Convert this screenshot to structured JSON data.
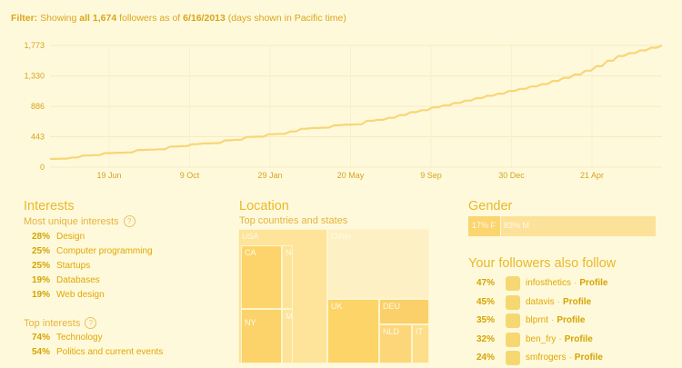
{
  "filter": {
    "label": "Filter:",
    "text1": " Showing ",
    "all_count": "all 1,674",
    "text2": " followers as of ",
    "date": "6/16/2013",
    "text3": " (days shown in Pacific time)"
  },
  "chart_data": {
    "type": "line",
    "x_tick_labels": [
      "19 Jun",
      "9 Oct",
      "29 Jan",
      "20 May",
      "9 Sep",
      "30 Dec",
      "21 Apr"
    ],
    "y_tick_labels": [
      "0",
      "443",
      "886",
      "1,330",
      "1,773"
    ],
    "ylim": [
      0,
      1773
    ],
    "grid": true,
    "series": [
      {
        "values": [
          120,
          125,
          140,
          170,
          175,
          205,
          210,
          215,
          250,
          255,
          260,
          300,
          305,
          335,
          345,
          350,
          390,
          400,
          440,
          445,
          480,
          485,
          520,
          560,
          570,
          575,
          610,
          620,
          625,
          675,
          690,
          720,
          760,
          800,
          830,
          870,
          900,
          935,
          970,
          1005,
          1040,
          1070,
          1110,
          1140,
          1175,
          1210,
          1255,
          1300,
          1350,
          1405,
          1470,
          1550,
          1620,
          1660,
          1700,
          1740,
          1773
        ]
      }
    ],
    "color": "#f7d678"
  },
  "interests": {
    "title": "Interests",
    "unique_title": "Most unique interests",
    "unique": [
      {
        "pct": "28%",
        "name": "Design"
      },
      {
        "pct": "25%",
        "name": "Computer programming"
      },
      {
        "pct": "25%",
        "name": "Startups"
      },
      {
        "pct": "19%",
        "name": "Databases"
      },
      {
        "pct": "19%",
        "name": "Web design"
      }
    ],
    "top_title": "Top interests",
    "top": [
      {
        "pct": "74%",
        "name": "Technology"
      },
      {
        "pct": "54%",
        "name": "Politics and current events"
      }
    ]
  },
  "location": {
    "title": "Location",
    "subtitle": "Top countries and states",
    "labels": {
      "usa": "USA",
      "ca": "CA",
      "n": "N",
      "ny": "NY",
      "m": "M",
      "other": "Other",
      "uk": "UK",
      "deu": "DEU",
      "nld": "NLD",
      "ita": "IT"
    }
  },
  "gender": {
    "title": "Gender",
    "female": "17% F",
    "male": "83% M",
    "female_fraction": 0.17
  },
  "also_follow": {
    "title": "Your followers also follow",
    "profile_label": "Profile",
    "separator": "·",
    "items": [
      {
        "pct": "47%",
        "name": "infosthetics"
      },
      {
        "pct": "45%",
        "name": "datavis"
      },
      {
        "pct": "35%",
        "name": "blprnt"
      },
      {
        "pct": "32%",
        "name": "ben_fry"
      },
      {
        "pct": "24%",
        "name": "smfrogers"
      }
    ]
  }
}
